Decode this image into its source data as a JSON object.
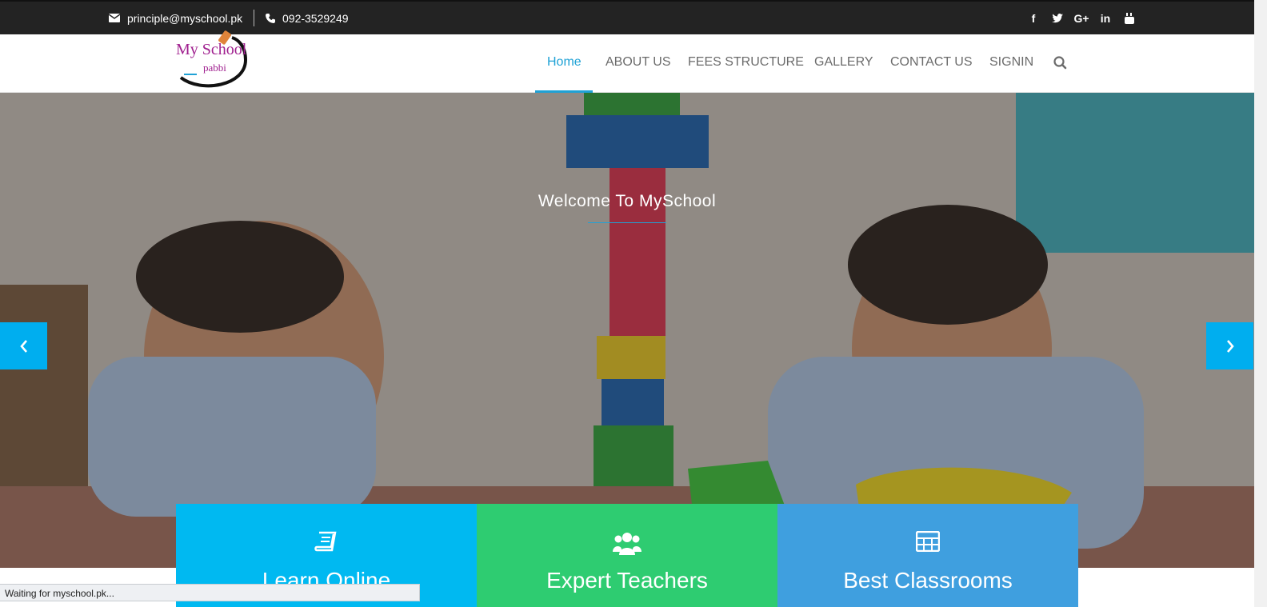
{
  "topbar": {
    "email": "principle@myschool.pk",
    "phone": "092-3529249",
    "social": [
      "facebook-icon",
      "twitter-icon",
      "google-plus-icon",
      "linkedin-icon",
      "youtube-icon"
    ],
    "social_glyphs": [
      "f",
      "🐦",
      "G+",
      "in",
      "▶"
    ]
  },
  "header": {
    "logo_line1": "My School",
    "logo_line2": "pabbi",
    "nav": [
      {
        "label": "Home",
        "active": true
      },
      {
        "label": "ABOUT US"
      },
      {
        "label": "FEES STRUCTURE"
      },
      {
        "label": "GALLERY"
      },
      {
        "label": "CONTACT US"
      },
      {
        "label": "SIGNIN"
      }
    ]
  },
  "hero": {
    "title": "Welcome To MySchool"
  },
  "features": [
    {
      "title": "Learn Online",
      "icon": "book-icon",
      "color": "#00b9f1"
    },
    {
      "title": "Expert Teachers",
      "icon": "users-icon",
      "color": "#2ecc71"
    },
    {
      "title": "Best Classrooms",
      "icon": "grid-icon",
      "color": "#3f9fdf"
    }
  ],
  "status": {
    "text": "Waiting for myschool.pk..."
  },
  "colors": {
    "accent": "#1fa2d6",
    "arrow": "#00aeef",
    "topbar": "#232323"
  }
}
